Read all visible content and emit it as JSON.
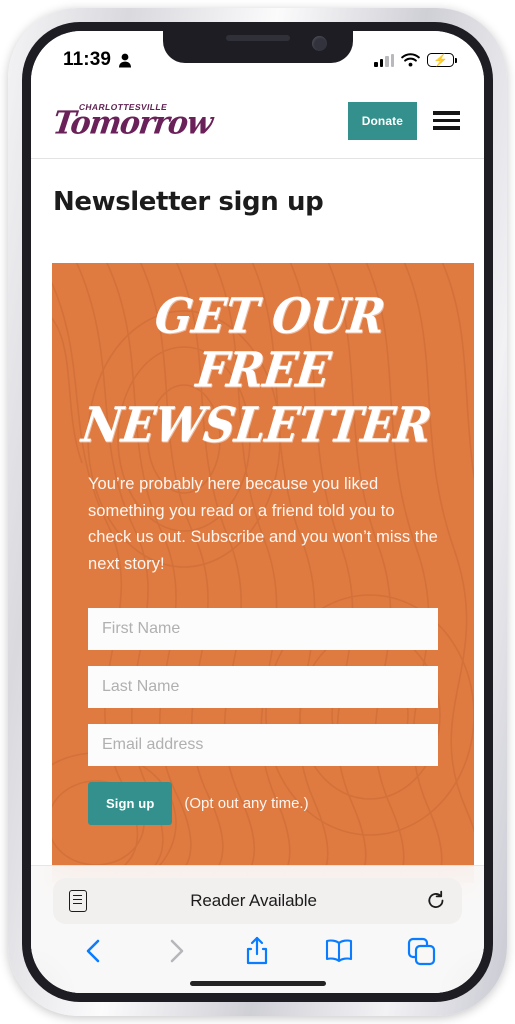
{
  "status_bar": {
    "time": "11:39",
    "person_icon": "person-icon",
    "signal_icon": "cellular-signal-icon",
    "wifi_icon": "wifi-icon",
    "battery_icon": "battery-charging-icon"
  },
  "site_header": {
    "logo_kicker": "CHARLOTTESVILLE",
    "logo_word": "Tomorrow",
    "donate_label": "Donate",
    "menu_icon": "hamburger-menu-icon"
  },
  "page": {
    "title": "Newsletter sign up"
  },
  "newsletter": {
    "headline_line1": "GET OUR FREE",
    "headline_line2": "NEWSLETTER",
    "blurb": "You’re probably here because you liked something you read or a friend told you to check us out. Subscribe and you won’t miss the next story!",
    "fields": [
      {
        "name": "first-name",
        "placeholder": "First Name",
        "value": ""
      },
      {
        "name": "last-name",
        "placeholder": "Last Name",
        "value": ""
      },
      {
        "name": "email",
        "placeholder": "Email address",
        "value": ""
      }
    ],
    "submit_label": "Sign up",
    "optout_note": "(Opt out any time.)",
    "colors": {
      "panel_background": "#df7a41",
      "accent_teal": "#34908c",
      "brand_purple": "#6a2159"
    }
  },
  "browser": {
    "address_bar_label": "Reader Available",
    "reader_icon": "reader-view-icon",
    "reload_icon": "reload-icon",
    "toolbar": [
      {
        "name": "back-button",
        "icon": "chevron-left-icon",
        "enabled": true
      },
      {
        "name": "forward-button",
        "icon": "chevron-right-icon",
        "enabled": false
      },
      {
        "name": "share-button",
        "icon": "share-icon",
        "enabled": true
      },
      {
        "name": "bookmarks-button",
        "icon": "book-icon",
        "enabled": true
      },
      {
        "name": "tabs-button",
        "icon": "tabs-icon",
        "enabled": true
      }
    ]
  }
}
